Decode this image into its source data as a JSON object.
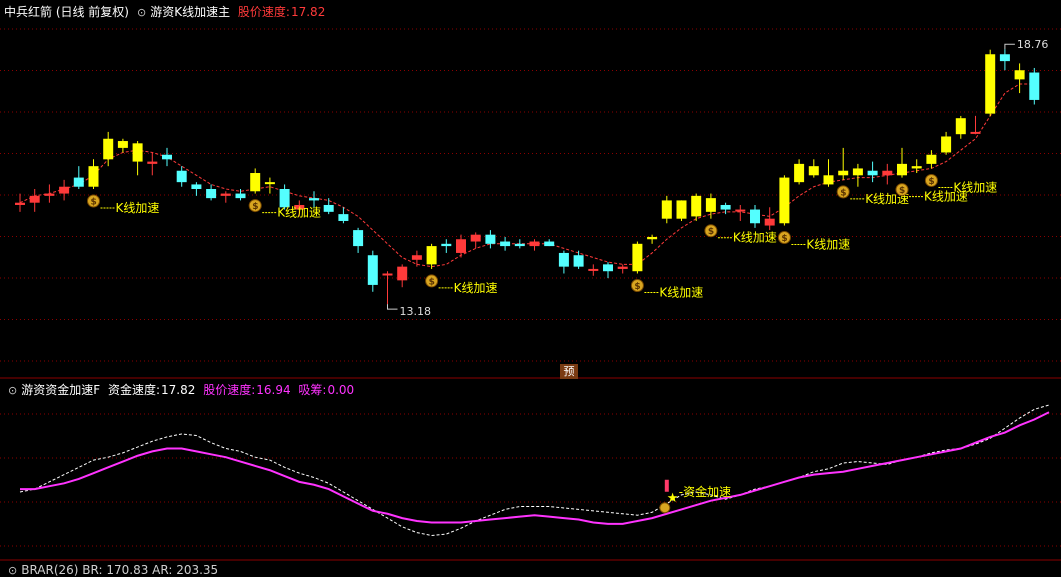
{
  "main_header": {
    "stock": "中兵红箭 (日线 前复权)",
    "indicator": "游资K线加速主",
    "speed_label": "股价速度:",
    "speed_value": "17.82"
  },
  "sub_header": {
    "indicator": "游资资金加速F",
    "fund_label": "资金速度:",
    "fund_value": "17.82",
    "price_label": "股价速度:",
    "price_value": "16.94",
    "absorb_label": "吸筹:",
    "absorb_value": "0.00"
  },
  "bottom_header": {
    "text": "BRAR(26) BR: 170.83 AR: 203.35"
  },
  "badge_label": "预",
  "colors": {
    "up": "#ff3a3a",
    "down": "#54ffff",
    "accel": "#ffff00",
    "grid_red": "#8b0000",
    "fund_line": "#ff33ff"
  },
  "chart_data": [
    {
      "type": "candlestick",
      "title": "游资K线加速主",
      "y_range": [
        12.0,
        19.4
      ],
      "max_label": "18.76",
      "min_label": "13.18",
      "candles": [
        {
          "o": 15.35,
          "h": 15.6,
          "l": 15.2,
          "c": 15.4,
          "t": "up"
        },
        {
          "o": 15.4,
          "h": 15.7,
          "l": 15.2,
          "c": 15.55,
          "t": "up"
        },
        {
          "o": 15.55,
          "h": 15.8,
          "l": 15.4,
          "c": 15.6,
          "t": "up"
        },
        {
          "o": 15.6,
          "h": 15.9,
          "l": 15.45,
          "c": 15.75,
          "t": "up"
        },
        {
          "o": 15.95,
          "h": 16.2,
          "l": 15.7,
          "c": 15.75,
          "t": "down"
        },
        {
          "o": 15.75,
          "h": 16.35,
          "l": 15.7,
          "c": 16.2,
          "t": "accel"
        },
        {
          "o": 16.35,
          "h": 16.95,
          "l": 16.2,
          "c": 16.8,
          "t": "accel"
        },
        {
          "o": 16.75,
          "h": 16.8,
          "l": 16.5,
          "c": 16.6,
          "t": "accel"
        },
        {
          "o": 16.7,
          "h": 16.75,
          "l": 16.0,
          "c": 16.3,
          "t": "accel"
        },
        {
          "o": 16.3,
          "h": 16.5,
          "l": 16.0,
          "c": 16.25,
          "t": "up"
        },
        {
          "o": 16.45,
          "h": 16.6,
          "l": 16.2,
          "c": 16.35,
          "t": "down"
        },
        {
          "o": 16.1,
          "h": 16.2,
          "l": 15.75,
          "c": 15.85,
          "t": "down"
        },
        {
          "o": 15.8,
          "h": 15.85,
          "l": 15.55,
          "c": 15.7,
          "t": "down"
        },
        {
          "o": 15.7,
          "h": 15.8,
          "l": 15.45,
          "c": 15.5,
          "t": "down"
        },
        {
          "o": 15.55,
          "h": 15.65,
          "l": 15.4,
          "c": 15.6,
          "t": "up"
        },
        {
          "o": 15.6,
          "h": 15.7,
          "l": 15.45,
          "c": 15.5,
          "t": "down"
        },
        {
          "o": 15.65,
          "h": 16.15,
          "l": 15.6,
          "c": 16.05,
          "t": "accel"
        },
        {
          "o": 15.85,
          "h": 15.95,
          "l": 15.6,
          "c": 15.85,
          "t": "accel"
        },
        {
          "o": 15.7,
          "h": 15.8,
          "l": 15.25,
          "c": 15.3,
          "t": "down"
        },
        {
          "o": 15.25,
          "h": 15.45,
          "l": 15.1,
          "c": 15.35,
          "t": "up"
        },
        {
          "o": 15.5,
          "h": 15.65,
          "l": 15.3,
          "c": 15.45,
          "t": "down"
        },
        {
          "o": 15.35,
          "h": 15.5,
          "l": 15.15,
          "c": 15.2,
          "t": "down"
        },
        {
          "o": 15.15,
          "h": 15.3,
          "l": 14.95,
          "c": 15.0,
          "t": "down"
        },
        {
          "o": 14.8,
          "h": 14.85,
          "l": 14.3,
          "c": 14.45,
          "t": "down"
        },
        {
          "o": 14.25,
          "h": 14.35,
          "l": 13.45,
          "c": 13.6,
          "t": "down"
        },
        {
          "o": 13.85,
          "h": 13.9,
          "l": 13.18,
          "c": 13.85,
          "t": "up"
        },
        {
          "o": 13.7,
          "h": 14.05,
          "l": 13.55,
          "c": 14.0,
          "t": "up"
        },
        {
          "o": 14.15,
          "h": 14.35,
          "l": 14.0,
          "c": 14.25,
          "t": "up"
        },
        {
          "o": 14.05,
          "h": 14.5,
          "l": 13.95,
          "c": 14.45,
          "t": "accel"
        },
        {
          "o": 14.45,
          "h": 14.6,
          "l": 14.3,
          "c": 14.5,
          "t": "down"
        },
        {
          "o": 14.3,
          "h": 14.7,
          "l": 14.2,
          "c": 14.6,
          "t": "up"
        },
        {
          "o": 14.55,
          "h": 14.75,
          "l": 14.4,
          "c": 14.7,
          "t": "up"
        },
        {
          "o": 14.7,
          "h": 14.8,
          "l": 14.4,
          "c": 14.5,
          "t": "down"
        },
        {
          "o": 14.55,
          "h": 14.65,
          "l": 14.35,
          "c": 14.45,
          "t": "down"
        },
        {
          "o": 14.5,
          "h": 14.6,
          "l": 14.4,
          "c": 14.45,
          "t": "down"
        },
        {
          "o": 14.45,
          "h": 14.6,
          "l": 14.35,
          "c": 14.55,
          "t": "up"
        },
        {
          "o": 14.55,
          "h": 14.6,
          "l": 14.45,
          "c": 14.45,
          "t": "down"
        },
        {
          "o": 14.3,
          "h": 14.35,
          "l": 13.85,
          "c": 14.0,
          "t": "down"
        },
        {
          "o": 14.25,
          "h": 14.35,
          "l": 13.95,
          "c": 14.0,
          "t": "down"
        },
        {
          "o": 13.95,
          "h": 14.05,
          "l": 13.8,
          "c": 13.95,
          "t": "up"
        },
        {
          "o": 13.9,
          "h": 14.1,
          "l": 13.75,
          "c": 14.05,
          "t": "down"
        },
        {
          "o": 13.95,
          "h": 14.05,
          "l": 13.85,
          "c": 14.0,
          "t": "up"
        },
        {
          "o": 13.9,
          "h": 14.55,
          "l": 13.85,
          "c": 14.5,
          "t": "accel"
        },
        {
          "o": 14.6,
          "h": 14.7,
          "l": 14.5,
          "c": 14.65,
          "t": "accel"
        },
        {
          "o": 15.05,
          "h": 15.55,
          "l": 14.95,
          "c": 15.45,
          "t": "accel"
        },
        {
          "o": 15.05,
          "h": 15.45,
          "l": 15.0,
          "c": 15.45,
          "t": "accel"
        },
        {
          "o": 15.55,
          "h": 15.6,
          "l": 15.0,
          "c": 15.1,
          "t": "accel"
        },
        {
          "o": 15.2,
          "h": 15.6,
          "l": 15.05,
          "c": 15.5,
          "t": "accel"
        },
        {
          "o": 15.35,
          "h": 15.4,
          "l": 15.15,
          "c": 15.25,
          "t": "down"
        },
        {
          "o": 15.25,
          "h": 15.35,
          "l": 15.0,
          "c": 15.25,
          "t": "up"
        },
        {
          "o": 15.25,
          "h": 15.35,
          "l": 14.85,
          "c": 14.95,
          "t": "down"
        },
        {
          "o": 14.9,
          "h": 15.3,
          "l": 14.8,
          "c": 15.05,
          "t": "up"
        },
        {
          "o": 14.95,
          "h": 16.0,
          "l": 14.9,
          "c": 15.95,
          "t": "accel"
        },
        {
          "o": 15.85,
          "h": 16.35,
          "l": 15.8,
          "c": 16.25,
          "t": "accel"
        },
        {
          "o": 16.2,
          "h": 16.35,
          "l": 15.95,
          "c": 16.0,
          "t": "accel"
        },
        {
          "o": 15.8,
          "h": 16.35,
          "l": 15.75,
          "c": 16.0,
          "t": "accel"
        },
        {
          "o": 16.0,
          "h": 16.6,
          "l": 15.9,
          "c": 16.1,
          "t": "accel"
        },
        {
          "o": 16.0,
          "h": 16.25,
          "l": 15.75,
          "c": 16.15,
          "t": "accel"
        },
        {
          "o": 16.1,
          "h": 16.3,
          "l": 15.85,
          "c": 16.0,
          "t": "down"
        },
        {
          "o": 16.0,
          "h": 16.25,
          "l": 15.8,
          "c": 16.1,
          "t": "up"
        },
        {
          "o": 16.0,
          "h": 16.6,
          "l": 15.95,
          "c": 16.25,
          "t": "accel"
        },
        {
          "o": 16.15,
          "h": 16.35,
          "l": 16.05,
          "c": 16.2,
          "t": "accel"
        },
        {
          "o": 16.25,
          "h": 16.55,
          "l": 16.15,
          "c": 16.45,
          "t": "accel"
        },
        {
          "o": 16.5,
          "h": 16.95,
          "l": 16.45,
          "c": 16.85,
          "t": "accel"
        },
        {
          "o": 16.9,
          "h": 17.3,
          "l": 16.8,
          "c": 17.25,
          "t": "accel"
        },
        {
          "o": 16.95,
          "h": 17.3,
          "l": 16.9,
          "c": 16.95,
          "t": "up"
        },
        {
          "o": 17.35,
          "h": 18.75,
          "l": 17.3,
          "c": 18.65,
          "t": "accel"
        },
        {
          "o": 18.65,
          "h": 18.76,
          "l": 18.3,
          "c": 18.5,
          "t": "down"
        },
        {
          "o": 18.3,
          "h": 18.45,
          "l": 17.8,
          "c": 18.1,
          "t": "accel"
        },
        {
          "o": 18.25,
          "h": 18.35,
          "l": 17.55,
          "c": 17.65,
          "t": "down"
        }
      ],
      "ma_line_dashed": [
        15.4,
        15.55,
        15.6,
        15.7,
        15.8,
        16.0,
        16.35,
        16.5,
        16.55,
        16.5,
        16.4,
        16.2,
        16.0,
        15.8,
        15.7,
        15.65,
        15.7,
        15.75,
        15.65,
        15.55,
        15.5,
        15.45,
        15.3,
        15.1,
        14.8,
        14.5,
        14.2,
        14.05,
        14.0,
        14.05,
        14.25,
        14.4,
        14.5,
        14.5,
        14.5,
        14.5,
        14.5,
        14.4,
        14.3,
        14.2,
        14.1,
        14.05,
        14.05,
        14.3,
        14.6,
        14.85,
        15.05,
        15.15,
        15.2,
        15.2,
        15.15,
        15.1,
        15.3,
        15.55,
        15.75,
        15.85,
        15.9,
        15.95,
        15.95,
        16.0,
        16.05,
        16.1,
        16.15,
        16.3,
        16.55,
        16.8,
        17.3,
        17.8,
        18.0,
        18.0
      ],
      "annotations": [
        {
          "i": 5,
          "label": "K线加速"
        },
        {
          "i": 16,
          "label": "K线加速"
        },
        {
          "i": 28,
          "label": "K线加速"
        },
        {
          "i": 42,
          "label": "K线加速"
        },
        {
          "i": 47,
          "label": "K线加速"
        },
        {
          "i": 52,
          "label": "K线加速"
        },
        {
          "i": 56,
          "label": "K线加速"
        },
        {
          "i": 60,
          "label": "K线加速"
        },
        {
          "i": 62,
          "label": "K线加速"
        }
      ]
    },
    {
      "type": "line",
      "title": "游资资金加速F",
      "y_range": [
        0,
        100
      ],
      "series": [
        {
          "name": "资金速度",
          "style": "dashed",
          "values": [
            40,
            42,
            47,
            52,
            57,
            62,
            64,
            67,
            71,
            75,
            78,
            80,
            79,
            74,
            70,
            68,
            64,
            62,
            57,
            53,
            50,
            46,
            40,
            34,
            28,
            22,
            16,
            12,
            10,
            11,
            15,
            20,
            24,
            28,
            30,
            30,
            30,
            29,
            28,
            27,
            26,
            25,
            24,
            26,
            32,
            38,
            40,
            38,
            35,
            38,
            42,
            44,
            47,
            50,
            54,
            56,
            60,
            61,
            60,
            59,
            62,
            64,
            67,
            69,
            70,
            73,
            77,
            84,
            91,
            97,
            100
          ]
        },
        {
          "name": "股价速度",
          "style": "solid",
          "values": [
            42,
            42,
            44,
            46,
            49,
            53,
            57,
            61,
            65,
            68,
            70,
            70,
            68,
            66,
            64,
            61,
            58,
            55,
            51,
            47,
            45,
            42,
            37,
            32,
            27,
            25,
            22,
            20,
            19,
            19,
            19,
            20,
            21,
            22,
            23,
            24,
            23,
            22,
            21,
            19,
            18,
            18,
            20,
            22,
            25,
            28,
            31,
            34,
            36,
            38,
            41,
            44,
            47,
            50,
            52,
            53,
            54,
            56,
            58,
            60,
            62,
            64,
            66,
            68,
            70,
            74,
            78,
            81,
            86,
            90,
            95
          ]
        }
      ],
      "annotations": [
        {
          "i": 44,
          "label": "资金加速"
        }
      ]
    }
  ]
}
